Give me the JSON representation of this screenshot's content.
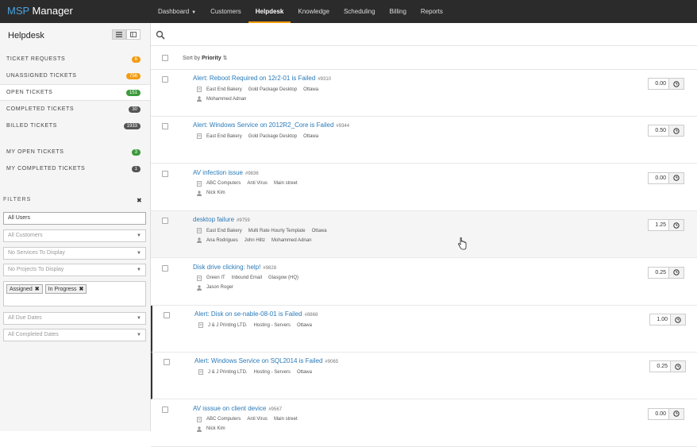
{
  "brand": {
    "part1": "MSP",
    "part2": " Manager",
    "accent_color": "#4aa3df"
  },
  "nav": {
    "items": [
      {
        "label": "Dashboard",
        "has_caret": true
      },
      {
        "label": "Customers"
      },
      {
        "label": "Helpdesk",
        "active": true
      },
      {
        "label": "Knowledge"
      },
      {
        "label": "Scheduling"
      },
      {
        "label": "Billing"
      },
      {
        "label": "Reports"
      }
    ],
    "active_color": "#f39c12"
  },
  "sidebar": {
    "title": "Helpdesk",
    "items": [
      {
        "label": "TICKET REQUESTS",
        "count": "6",
        "color": "#f39c12"
      },
      {
        "label": "UNASSIGNED TICKETS",
        "count": "756",
        "color": "#f39c12"
      },
      {
        "label": "OPEN TICKETS",
        "count": "151",
        "color": "#3c9a3c",
        "active": true
      },
      {
        "label": "COMPLETED TICKETS",
        "count": "30",
        "color": "#555555"
      },
      {
        "label": "BILLED TICKETS",
        "count": "1933",
        "color": "#555555"
      },
      {
        "label": "MY OPEN TICKETS",
        "count": "3",
        "color": "#3c9a3c"
      },
      {
        "label": "MY COMPLETED TICKETS",
        "count": "1",
        "color": "#555555"
      }
    ]
  },
  "filters": {
    "title": "FILTERS",
    "users": "All Users",
    "customers": "All Customers",
    "services": "No Services To Display",
    "projects": "No Projects To Display",
    "status_tags": [
      "Assigned",
      "In Progress"
    ],
    "due_dates": "All Due Dates",
    "completed_dates": "All Completed Dates"
  },
  "sort": {
    "prefix": "Sort by",
    "field": "Priority"
  },
  "tickets": [
    {
      "title": "Alert: Reboot Required on 12r2-01 is Failed",
      "number": "#9310",
      "customer": "East End Bakery",
      "service": "Gold Package Desktop",
      "location": "Ottawa",
      "assignees": [
        "Mohammed Adnan"
      ],
      "hours": "0.00"
    },
    {
      "title": "Alert: Windows Service on 2012R2_Core is Failed",
      "number": "#9344",
      "customer": "East End Bakery",
      "service": "Gold Package Desktop",
      "location": "Ottawa",
      "assignees": [],
      "hours": "0.50"
    },
    {
      "title": "AV infection issue",
      "number": "#9836",
      "customer": "ABC Computers",
      "service": "Anti Virus",
      "location": "Main street",
      "assignees": [
        "Nick Kim"
      ],
      "hours": "0.00"
    },
    {
      "title": "desktop failure",
      "number": "#9759",
      "customer": "East End Bakery",
      "service": "Multi Rate Hourly Template",
      "location": "Ottawa",
      "assignees": [
        "Ana Rodrigues",
        "John Hiltz",
        "Mohammed Adnan"
      ],
      "hours": "1.25",
      "hover": true
    },
    {
      "title": "Disk drive clicking: help!",
      "number": "#9828",
      "customer": "Green IT",
      "service": "Inbound Email",
      "location": "Glasgow (HQ)",
      "assignees": [
        "Jason Roger"
      ],
      "hours": "0.25"
    },
    {
      "title": "Alert: Disk on se-nable-08-01 is Failed",
      "number": "#8868",
      "customer": "J & J Printing LTD.",
      "service": "Hosting - Servers",
      "location": "Ottawa",
      "assignees": [],
      "hours": "1.00",
      "flag": true
    },
    {
      "title": "Alert: Windows Service on SQL2014 is Failed",
      "number": "#9065",
      "customer": "J & J Printing LTD.",
      "service": "Hosting - Servers",
      "location": "Ottawa",
      "assignees": [],
      "hours": "0.25",
      "flag": true
    },
    {
      "title": "AV isssue on client device",
      "number": "#9567",
      "customer": "ABC Computers",
      "service": "Anti Virus",
      "location": "Main street",
      "assignees": [
        "Nick Kim"
      ],
      "hours": "0.00"
    }
  ]
}
